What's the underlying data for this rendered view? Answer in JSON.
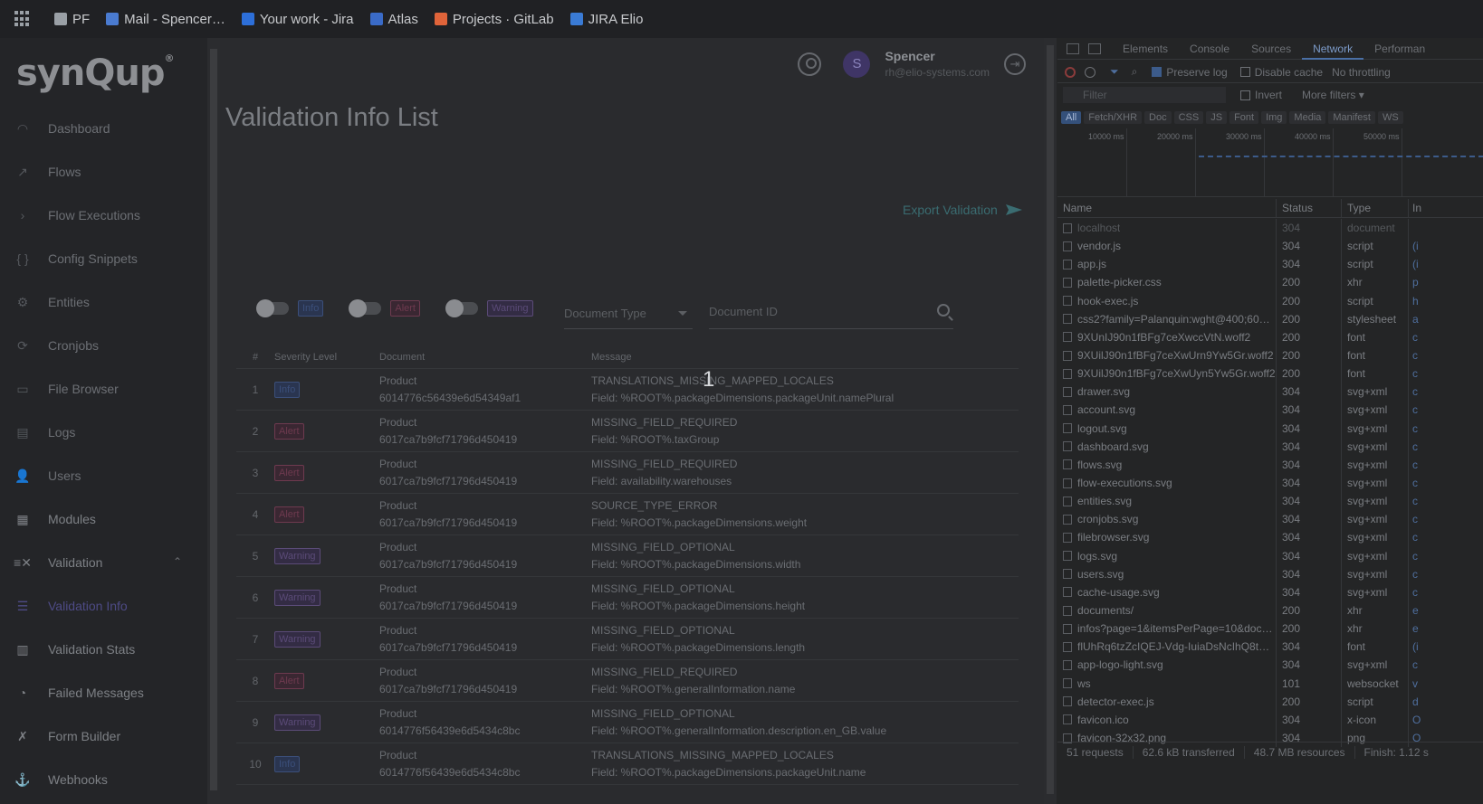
{
  "bookmarks": [
    {
      "label": "PF",
      "color": "#9aa0a6"
    },
    {
      "label": "Mail - Spencer…",
      "color": "#4a7bd0"
    },
    {
      "label": "Your work - Jira",
      "color": "#2d6fd9"
    },
    {
      "label": "Atlas",
      "color": "#3a6bc8"
    },
    {
      "label": "Projects · GitLab",
      "color": "#e0643a"
    },
    {
      "label": "JIRA Elio",
      "color": "#3a7bd5"
    }
  ],
  "app": {
    "logo": "synQup",
    "logo_mark": "®"
  },
  "sidebar": {
    "items": [
      {
        "label": "Dashboard",
        "icon": "◠"
      },
      {
        "label": "Flows",
        "icon": "↗"
      },
      {
        "label": "Flow Executions",
        "icon": "›"
      },
      {
        "label": "Config Snippets",
        "icon": "{ }"
      },
      {
        "label": "Entities",
        "icon": "⚙"
      },
      {
        "label": "Cronjobs",
        "icon": "⟳"
      },
      {
        "label": "File Browser",
        "icon": "▭"
      },
      {
        "label": "Logs",
        "icon": "▤"
      },
      {
        "label": "Users",
        "icon": "👤"
      },
      {
        "label": "Modules",
        "icon": "▦"
      },
      {
        "label": "Validation",
        "icon": "≡✕"
      },
      {
        "label": "Validation Info",
        "icon": "☰"
      },
      {
        "label": "Validation Stats",
        "icon": "▥"
      },
      {
        "label": "Failed Messages",
        "icon": "◔"
      },
      {
        "label": "Form Builder",
        "icon": "✗"
      },
      {
        "label": "Webhooks",
        "icon": "⚓"
      }
    ],
    "validation_chevron": "⌃"
  },
  "header": {
    "user_name": "Spencer",
    "user_email": "rh@elio-systems.com",
    "avatar_initial": "S",
    "logout_glyph": "⇥"
  },
  "page": {
    "title": "Validation Info List",
    "export_label": "Export Validation"
  },
  "filters": {
    "info_label": "Info",
    "alert_label": "Alert",
    "warning_label": "Warning",
    "document_type_placeholder": "Document Type",
    "document_id_placeholder": "Document ID"
  },
  "table": {
    "headers": {
      "n": "#",
      "severity": "Severity Level",
      "document": "Document",
      "message": "Message"
    },
    "rows": [
      {
        "n": "1",
        "severity": "Info",
        "sev": "info",
        "doc_type": "Product",
        "doc_id": "6014776c56439e6d54349af1",
        "msg": "TRANSLATIONS_MISSING_MAPPED_LOCALES",
        "field": "Field: %ROOT%.packageDimensions.packageUnit.namePlural"
      },
      {
        "n": "2",
        "severity": "Alert",
        "sev": "alert",
        "doc_type": "Product",
        "doc_id": "6017ca7b9fcf71796d450419",
        "msg": "MISSING_FIELD_REQUIRED",
        "field": "Field: %ROOT%.taxGroup"
      },
      {
        "n": "3",
        "severity": "Alert",
        "sev": "alert",
        "doc_type": "Product",
        "doc_id": "6017ca7b9fcf71796d450419",
        "msg": "MISSING_FIELD_REQUIRED",
        "field": "Field: availability.warehouses"
      },
      {
        "n": "4",
        "severity": "Alert",
        "sev": "alert",
        "doc_type": "Product",
        "doc_id": "6017ca7b9fcf71796d450419",
        "msg": "SOURCE_TYPE_ERROR",
        "field": "Field: %ROOT%.packageDimensions.weight"
      },
      {
        "n": "5",
        "severity": "Warning",
        "sev": "warning",
        "doc_type": "Product",
        "doc_id": "6017ca7b9fcf71796d450419",
        "msg": "MISSING_FIELD_OPTIONAL",
        "field": "Field: %ROOT%.packageDimensions.width"
      },
      {
        "n": "6",
        "severity": "Warning",
        "sev": "warning",
        "doc_type": "Product",
        "doc_id": "6017ca7b9fcf71796d450419",
        "msg": "MISSING_FIELD_OPTIONAL",
        "field": "Field: %ROOT%.packageDimensions.height"
      },
      {
        "n": "7",
        "severity": "Warning",
        "sev": "warning",
        "doc_type": "Product",
        "doc_id": "6017ca7b9fcf71796d450419",
        "msg": "MISSING_FIELD_OPTIONAL",
        "field": "Field: %ROOT%.packageDimensions.length"
      },
      {
        "n": "8",
        "severity": "Alert",
        "sev": "alert",
        "doc_type": "Product",
        "doc_id": "6017ca7b9fcf71796d450419",
        "msg": "MISSING_FIELD_REQUIRED",
        "field": "Field: %ROOT%.generalInformation.name"
      },
      {
        "n": "9",
        "severity": "Warning",
        "sev": "warning",
        "doc_type": "Product",
        "doc_id": "6014776f56439e6d5434c8bc",
        "msg": "MISSING_FIELD_OPTIONAL",
        "field": "Field: %ROOT%.generalInformation.description.en_GB.value"
      },
      {
        "n": "10",
        "severity": "Info",
        "sev": "info",
        "doc_type": "Product",
        "doc_id": "6014776f56439e6d5434c8bc",
        "msg": "TRANSLATIONS_MISSING_MAPPED_LOCALES",
        "field": "Field: %ROOT%.packageDimensions.packageUnit.name"
      }
    ]
  },
  "overlay_number": "1",
  "devtools": {
    "tabs": [
      "Elements",
      "Console",
      "Sources",
      "Network",
      "Performan"
    ],
    "active_tab": "Network",
    "preserve_log": "Preserve log",
    "disable_cache": "Disable cache",
    "throttling": "No throttling",
    "filter_placeholder": "Filter",
    "invert": "Invert",
    "more_filters": "More filters ▾",
    "type_chips": [
      "All",
      "Fetch/XHR",
      "Doc",
      "CSS",
      "JS",
      "Font",
      "Img",
      "Media",
      "Manifest",
      "WS"
    ],
    "timeline_labels": [
      "10000 ms",
      "20000 ms",
      "30000 ms",
      "40000 ms",
      "50000 ms"
    ],
    "columns": {
      "name": "Name",
      "status": "Status",
      "type": "Type",
      "initiator": "In"
    },
    "requests": [
      {
        "name": "localhost",
        "status": "304",
        "type": "document",
        "init": "",
        "dim": true
      },
      {
        "name": "vendor.js",
        "status": "304",
        "type": "script",
        "init": "(i"
      },
      {
        "name": "app.js",
        "status": "304",
        "type": "script",
        "init": "(i"
      },
      {
        "name": "palette-picker.css",
        "status": "200",
        "type": "xhr",
        "init": "p"
      },
      {
        "name": "hook-exec.js",
        "status": "200",
        "type": "script",
        "init": "h"
      },
      {
        "name": "css2?family=Palanquin:wght@400;600;…",
        "status": "200",
        "type": "stylesheet",
        "init": "a"
      },
      {
        "name": "9XUnIJ90n1fBFg7ceXwccVtN.woff2",
        "status": "200",
        "type": "font",
        "init": "c"
      },
      {
        "name": "9XUilJ90n1fBFg7ceXwUrn9Yw5Gr.woff2",
        "status": "200",
        "type": "font",
        "init": "c"
      },
      {
        "name": "9XUilJ90n1fBFg7ceXwUyn5Yw5Gr.woff2",
        "status": "200",
        "type": "font",
        "init": "c"
      },
      {
        "name": "drawer.svg",
        "status": "304",
        "type": "svg+xml",
        "init": "c"
      },
      {
        "name": "account.svg",
        "status": "304",
        "type": "svg+xml",
        "init": "c"
      },
      {
        "name": "logout.svg",
        "status": "304",
        "type": "svg+xml",
        "init": "c"
      },
      {
        "name": "dashboard.svg",
        "status": "304",
        "type": "svg+xml",
        "init": "c"
      },
      {
        "name": "flows.svg",
        "status": "304",
        "type": "svg+xml",
        "init": "c"
      },
      {
        "name": "flow-executions.svg",
        "status": "304",
        "type": "svg+xml",
        "init": "c"
      },
      {
        "name": "entities.svg",
        "status": "304",
        "type": "svg+xml",
        "init": "c"
      },
      {
        "name": "cronjobs.svg",
        "status": "304",
        "type": "svg+xml",
        "init": "c"
      },
      {
        "name": "filebrowser.svg",
        "status": "304",
        "type": "svg+xml",
        "init": "c"
      },
      {
        "name": "logs.svg",
        "status": "304",
        "type": "svg+xml",
        "init": "c"
      },
      {
        "name": "users.svg",
        "status": "304",
        "type": "svg+xml",
        "init": "c"
      },
      {
        "name": "cache-usage.svg",
        "status": "304",
        "type": "svg+xml",
        "init": "c"
      },
      {
        "name": "documents/",
        "status": "200",
        "type": "xhr",
        "init": "e"
      },
      {
        "name": "infos?page=1&itemsPerPage=10&docu…",
        "status": "200",
        "type": "xhr",
        "init": "e"
      },
      {
        "name": "flUhRq6tzZcIQEJ-Vdg-IuiaDsNcIhQ8tQ…",
        "status": "304",
        "type": "font",
        "init": "(i"
      },
      {
        "name": "app-logo-light.svg",
        "status": "304",
        "type": "svg+xml",
        "init": "c"
      },
      {
        "name": "ws",
        "status": "101",
        "type": "websocket",
        "init": "v"
      },
      {
        "name": "detector-exec.js",
        "status": "200",
        "type": "script",
        "init": "d"
      },
      {
        "name": "favicon.ico",
        "status": "304",
        "type": "x-icon",
        "init": "O"
      },
      {
        "name": "favicon-32x32.png",
        "status": "304",
        "type": "png",
        "init": "O"
      }
    ],
    "footer": {
      "requests": "51 requests",
      "transferred": "62.6 kB transferred",
      "resources": "48.7 MB resources",
      "finish": "Finish: 1.12 s"
    }
  },
  "colors": {
    "accent": "#4e4b86",
    "info": "#3b4f7a",
    "alert": "#6e3a4f",
    "warning": "#5b4b78",
    "export": "#3a6c71"
  }
}
